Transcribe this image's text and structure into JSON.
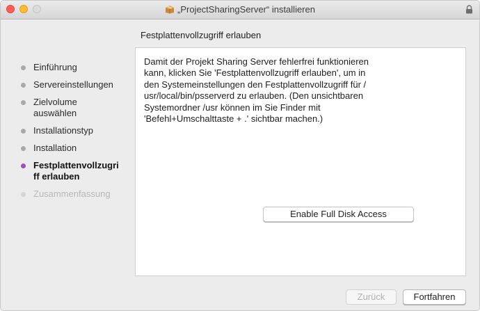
{
  "window": {
    "title": "„ProjectSharingServer“ installieren",
    "icons": {
      "package": "package-icon",
      "lock": "lock-icon"
    },
    "traffic_lights": {
      "close": "#fd5f57",
      "minimize": "#fdbc2e",
      "zoom": "#dcdcdc"
    }
  },
  "page": {
    "heading": "Festplattenvollzugriff erlauben"
  },
  "sidebar": {
    "steps": [
      {
        "label_lines": [
          "Einführung"
        ],
        "state": "done"
      },
      {
        "label_lines": [
          "Servereinstellungen"
        ],
        "state": "done"
      },
      {
        "label_lines": [
          "Zielvolume",
          "auswählen"
        ],
        "state": "done"
      },
      {
        "label_lines": [
          "Installationstyp"
        ],
        "state": "done"
      },
      {
        "label_lines": [
          "Installation"
        ],
        "state": "done"
      },
      {
        "label_lines": [
          "Festplattenvollzugri",
          "ff erlauben"
        ],
        "state": "active"
      },
      {
        "label_lines": [
          "Zusammenfassung"
        ],
        "state": "pending"
      }
    ],
    "active_color": "#a24cc2"
  },
  "content": {
    "lines": [
      "Damit der Projekt Sharing Server fehlerfrei funktionieren",
      "kann, klicken Sie 'Festplattenvollzugriff erlauben', um in",
      "den Systemeinstellungen den Festplattenvollzugriff für /",
      "usr/local/bin/psserverd zu erlauben. (Den unsichtbaren",
      "Systemordner /usr können im Sie Finder mit",
      "'Befehl+Umschalttaste + .' sichtbar machen.)"
    ],
    "action_button": "Enable Full Disk Access"
  },
  "footer": {
    "back_label": "Zurück",
    "continue_label": "Fortfahren"
  }
}
